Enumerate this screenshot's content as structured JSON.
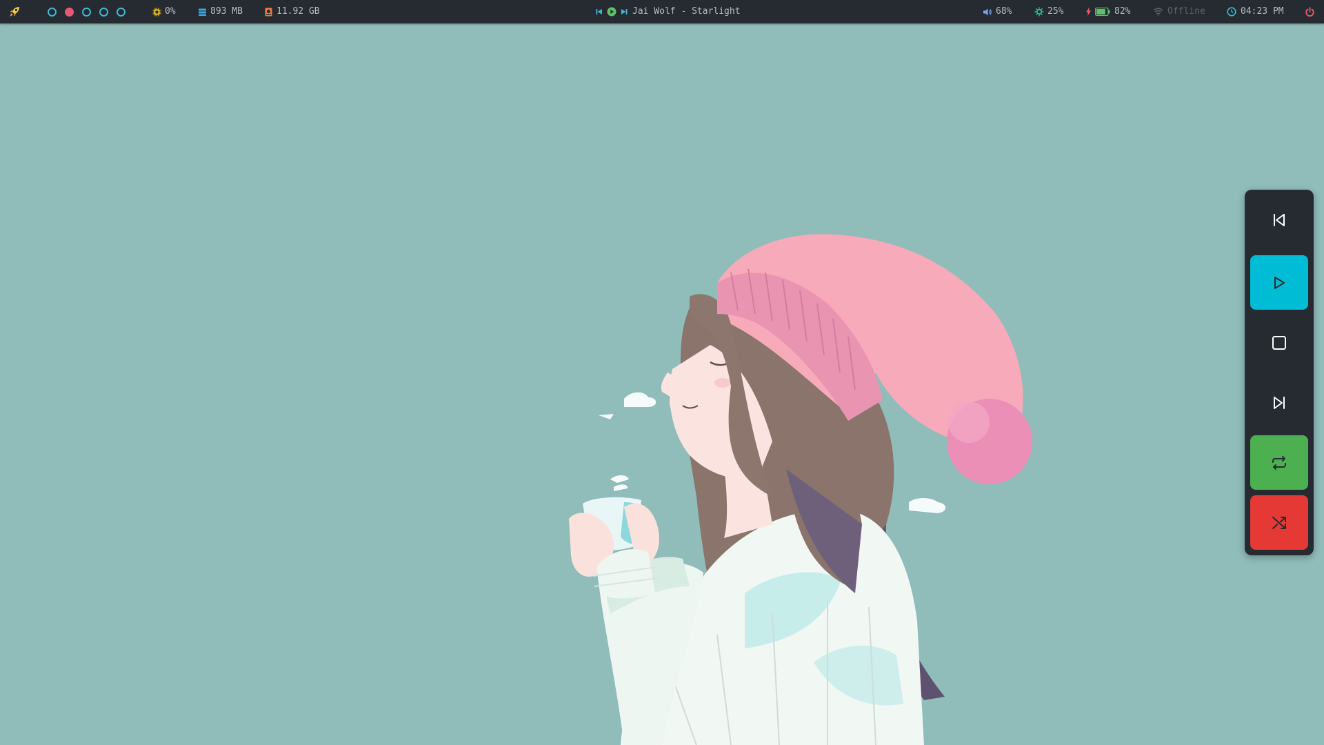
{
  "topbar": {
    "launcher_icon": "rocket-icon",
    "workspaces": [
      {
        "state": "empty"
      },
      {
        "state": "active"
      },
      {
        "state": "empty"
      },
      {
        "state": "empty"
      },
      {
        "state": "empty"
      }
    ],
    "cpu": {
      "icon": "cpu-icon",
      "value": "0%"
    },
    "memory": {
      "icon": "memory-icon",
      "value": "893 MB"
    },
    "disk": {
      "icon": "disk-icon",
      "value": "11.92 GB"
    },
    "player": {
      "prev_icon": "previous-icon",
      "play_icon": "play-icon",
      "next_icon": "next-icon",
      "track": "Jai Wolf - Starlight"
    },
    "volume": {
      "icon": "volume-icon",
      "value": "68%"
    },
    "brightness": {
      "icon": "brightness-icon",
      "value": "25%"
    },
    "battery": {
      "icon": "battery-icon",
      "value": "82%",
      "level": 0.82
    },
    "network": {
      "icon": "wifi-icon",
      "value": "Offline"
    },
    "clock": {
      "icon": "clock-icon",
      "value": "04:23 PM"
    },
    "power_icon": "power-icon"
  },
  "media_panel": {
    "buttons": [
      {
        "name": "previous",
        "icon": "skip-previous-icon",
        "color": "#252b30"
      },
      {
        "name": "play",
        "icon": "play-icon",
        "color": "#00bcd4"
      },
      {
        "name": "stop",
        "icon": "stop-icon",
        "color": "#252b30"
      },
      {
        "name": "next",
        "icon": "skip-next-icon",
        "color": "#252b30"
      },
      {
        "name": "repeat",
        "icon": "repeat-icon",
        "color": "#4caf50"
      },
      {
        "name": "shuffle",
        "icon": "shuffle-icon",
        "color": "#e53935"
      }
    ]
  },
  "colors": {
    "bar_background": "#252b30",
    "wallpaper_background": "#90bcb9",
    "accent_cyan": "#00bcd4",
    "accent_green": "#4caf50",
    "accent_red": "#e53935",
    "workspace_active": "#e45a72"
  }
}
